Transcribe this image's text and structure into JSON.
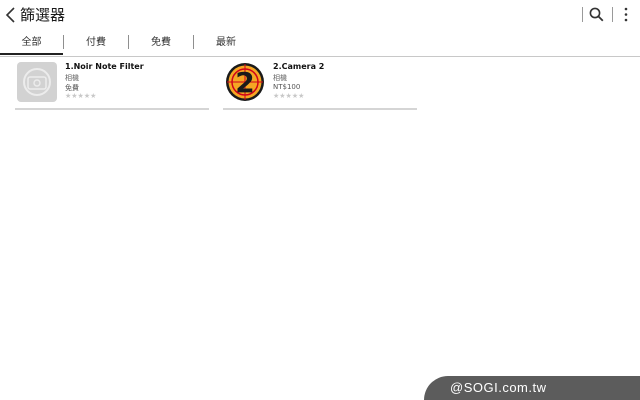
{
  "header": {
    "title": "篩選器",
    "back_icon": "chevron-left-icon",
    "search_icon": "search-icon",
    "more_icon": "more-vertical-icon"
  },
  "tabs": [
    {
      "label": "全部",
      "active": true
    },
    {
      "label": "付費",
      "active": false
    },
    {
      "label": "免費",
      "active": false
    },
    {
      "label": "最新",
      "active": false
    }
  ],
  "apps": [
    {
      "name": "1.Noir Note Filter",
      "category": "相機",
      "price": "免費",
      "stars": "★★★★★",
      "rating": 0
    },
    {
      "name": "2.Camera 2",
      "category": "相機",
      "price": "NT$100",
      "stars": "★★★★★",
      "rating": 0
    }
  ],
  "watermark": {
    "text": "@SOGI.com.tw"
  },
  "colors": {
    "background": "#ffffff",
    "divider": "#c8c8c8",
    "camera2_orange": "#f5a623",
    "camera2_red": "#d0021b",
    "watermark_bg": "#5c5c5c"
  }
}
